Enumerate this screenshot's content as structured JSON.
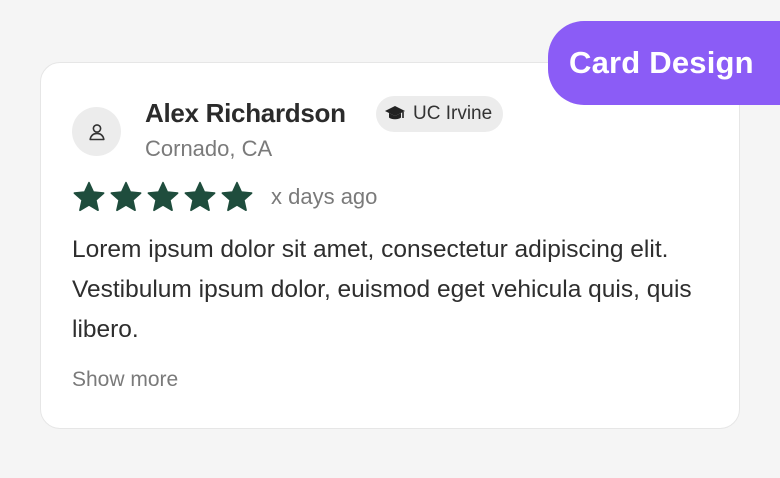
{
  "tag": {
    "label": "Card Design"
  },
  "review": {
    "name": "Alex Richardson",
    "school": "UC Irvine",
    "location": "Cornado, CA",
    "rating": 5,
    "rating_max": 5,
    "time": "x days ago",
    "text": "Lorem ipsum dolor sit amet, consectetur adipiscing elit. Vestibulum ipsum dolor, euismod eget vehicula quis, quis libero.",
    "show_more": "Show more"
  },
  "icons": {
    "avatar": "user-icon",
    "badge": "graduation-cap-icon",
    "star": "star-icon"
  },
  "colors": {
    "tag_background": "#8b5cf6",
    "star": "#1f4d3d",
    "page_background": "#f5f5f5",
    "card_background": "#ffffff"
  }
}
